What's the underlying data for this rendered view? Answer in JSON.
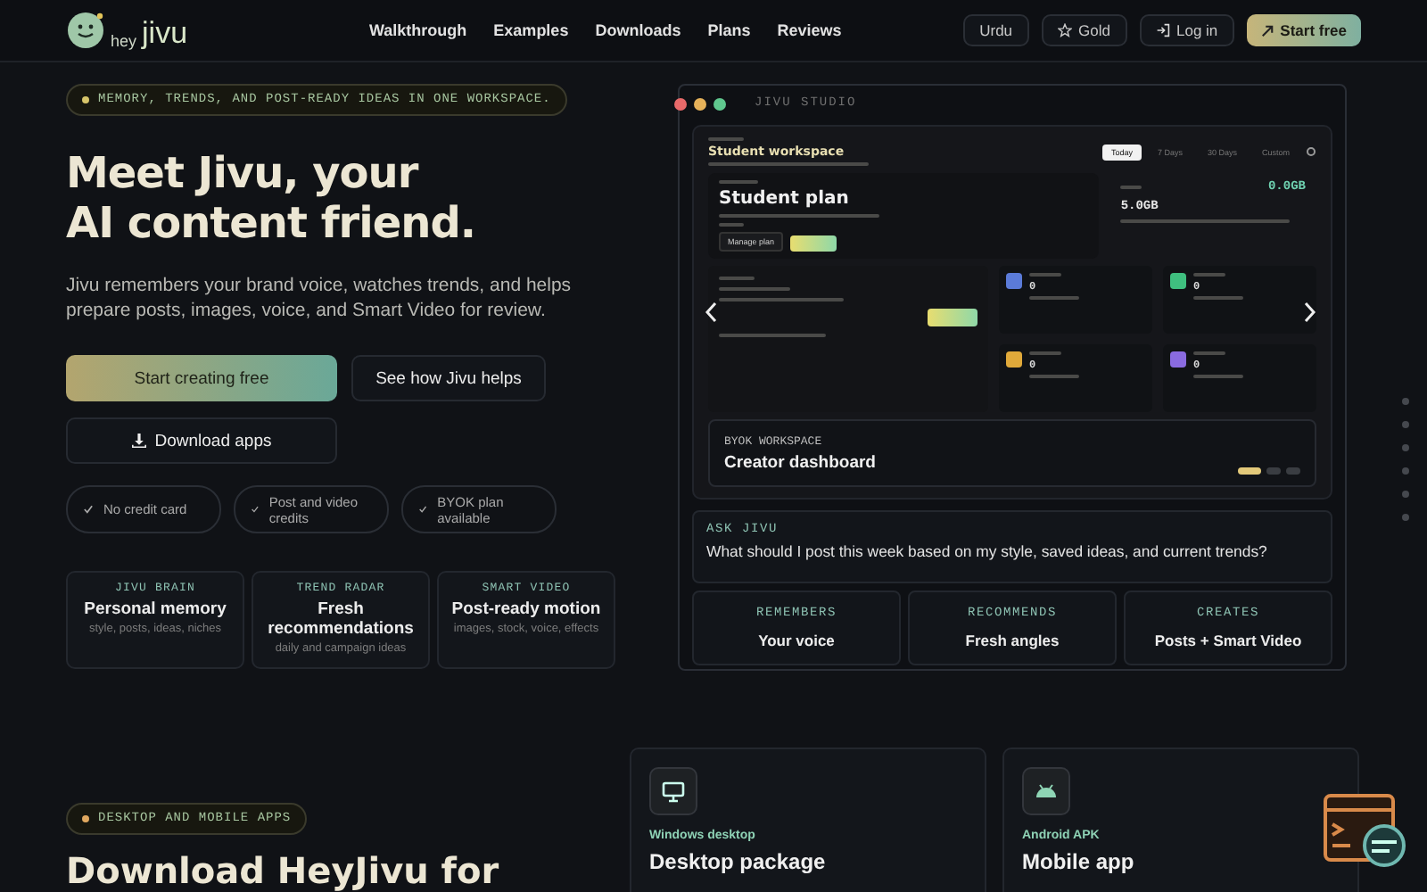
{
  "header": {
    "logo_prefix": "hey",
    "logo_name": "jivu",
    "nav": [
      "Walkthrough",
      "Examples",
      "Downloads",
      "Plans",
      "Reviews"
    ],
    "language": "Urdu",
    "tier": "Gold",
    "login": "Log in",
    "cta": "Start free"
  },
  "hero": {
    "badge": "MEMORY, TRENDS, AND POST-READY IDEAS IN ONE WORKSPACE.",
    "title_lines": [
      "Meet Jivu, your",
      "AI content friend."
    ],
    "description": "Jivu remembers your brand voice, watches trends, and helps prepare posts, images, voice, and Smart Video for review.",
    "primary_button": "Start creating free",
    "secondary_button": "See how Jivu helps",
    "download_button": "Download apps",
    "perks": [
      "No credit card",
      "Post and video credits",
      "BYOK plan available"
    ],
    "features": [
      {
        "eyebrow": "JIVU BRAIN",
        "title": "Personal memory",
        "detail": "style, posts, ideas, niches"
      },
      {
        "eyebrow": "TREND RADAR",
        "title": "Fresh recommendations",
        "detail": "daily and campaign ideas"
      },
      {
        "eyebrow": "SMART VIDEO",
        "title": "Post-ready motion",
        "detail": "images, stock, voice, effects"
      }
    ]
  },
  "studio": {
    "title": "JIVU STUDIO",
    "workspace_title": "Student workspace",
    "tabs": [
      {
        "label": "Today",
        "selected": true
      },
      {
        "label": "7 Days",
        "selected": false
      },
      {
        "label": "30 Days",
        "selected": false
      },
      {
        "label": "Custom",
        "selected": false
      }
    ],
    "plan_title": "Student plan",
    "manage_button": "Manage plan",
    "storage_total": "5.0GB",
    "storage_used": "0.0GB",
    "tiles": [
      {
        "value": "0",
        "color": "#5b7bd8"
      },
      {
        "value": "0",
        "color": "#3fbf7f"
      },
      {
        "value": "0",
        "color": "#e0a93a"
      },
      {
        "value": "0",
        "color": "#8a6be0"
      }
    ],
    "slide_eyebrow": "BYOK WORKSPACE",
    "slide_title": "Creator dashboard",
    "slides": [
      {
        "selected": true
      },
      {
        "selected": false
      },
      {
        "selected": false
      }
    ],
    "ask_label": "ASK JIVU",
    "ask_question": "What should I post this week based on my style, saved ideas, and current trends?",
    "stats": [
      {
        "label": "REMEMBERS",
        "value": "Your voice"
      },
      {
        "label": "RECOMMENDS",
        "value": "Fresh angles"
      },
      {
        "label": "CREATES",
        "value": "Posts + Smart Video"
      }
    ]
  },
  "downloads": {
    "badge": "DESKTOP AND MOBILE APPS",
    "title": "Download HeyJivu for",
    "cards": [
      {
        "kind": "desktop",
        "platform": "Windows desktop",
        "title": "Desktop package"
      },
      {
        "kind": "android",
        "platform": "Android APK",
        "title": "Mobile app"
      }
    ]
  }
}
